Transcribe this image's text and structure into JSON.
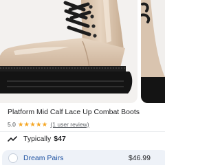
{
  "product": {
    "title": "Platform Mid Calf Lace Up Combat Boots",
    "rating_value": "5.0",
    "stars": "★★★★★",
    "review_count_label": "(1 user review)"
  },
  "price_insight": {
    "label": "Typically",
    "value": "$47"
  },
  "offer": {
    "store_name": "Dream Pairs",
    "price": "$46.99"
  },
  "icons": {
    "trend": "price-trend-icon",
    "store": "store-logo-icon"
  },
  "colors": {
    "stars": "#f5a623",
    "store_link": "#1a4fa0",
    "offer_background": "#eef2f8"
  }
}
